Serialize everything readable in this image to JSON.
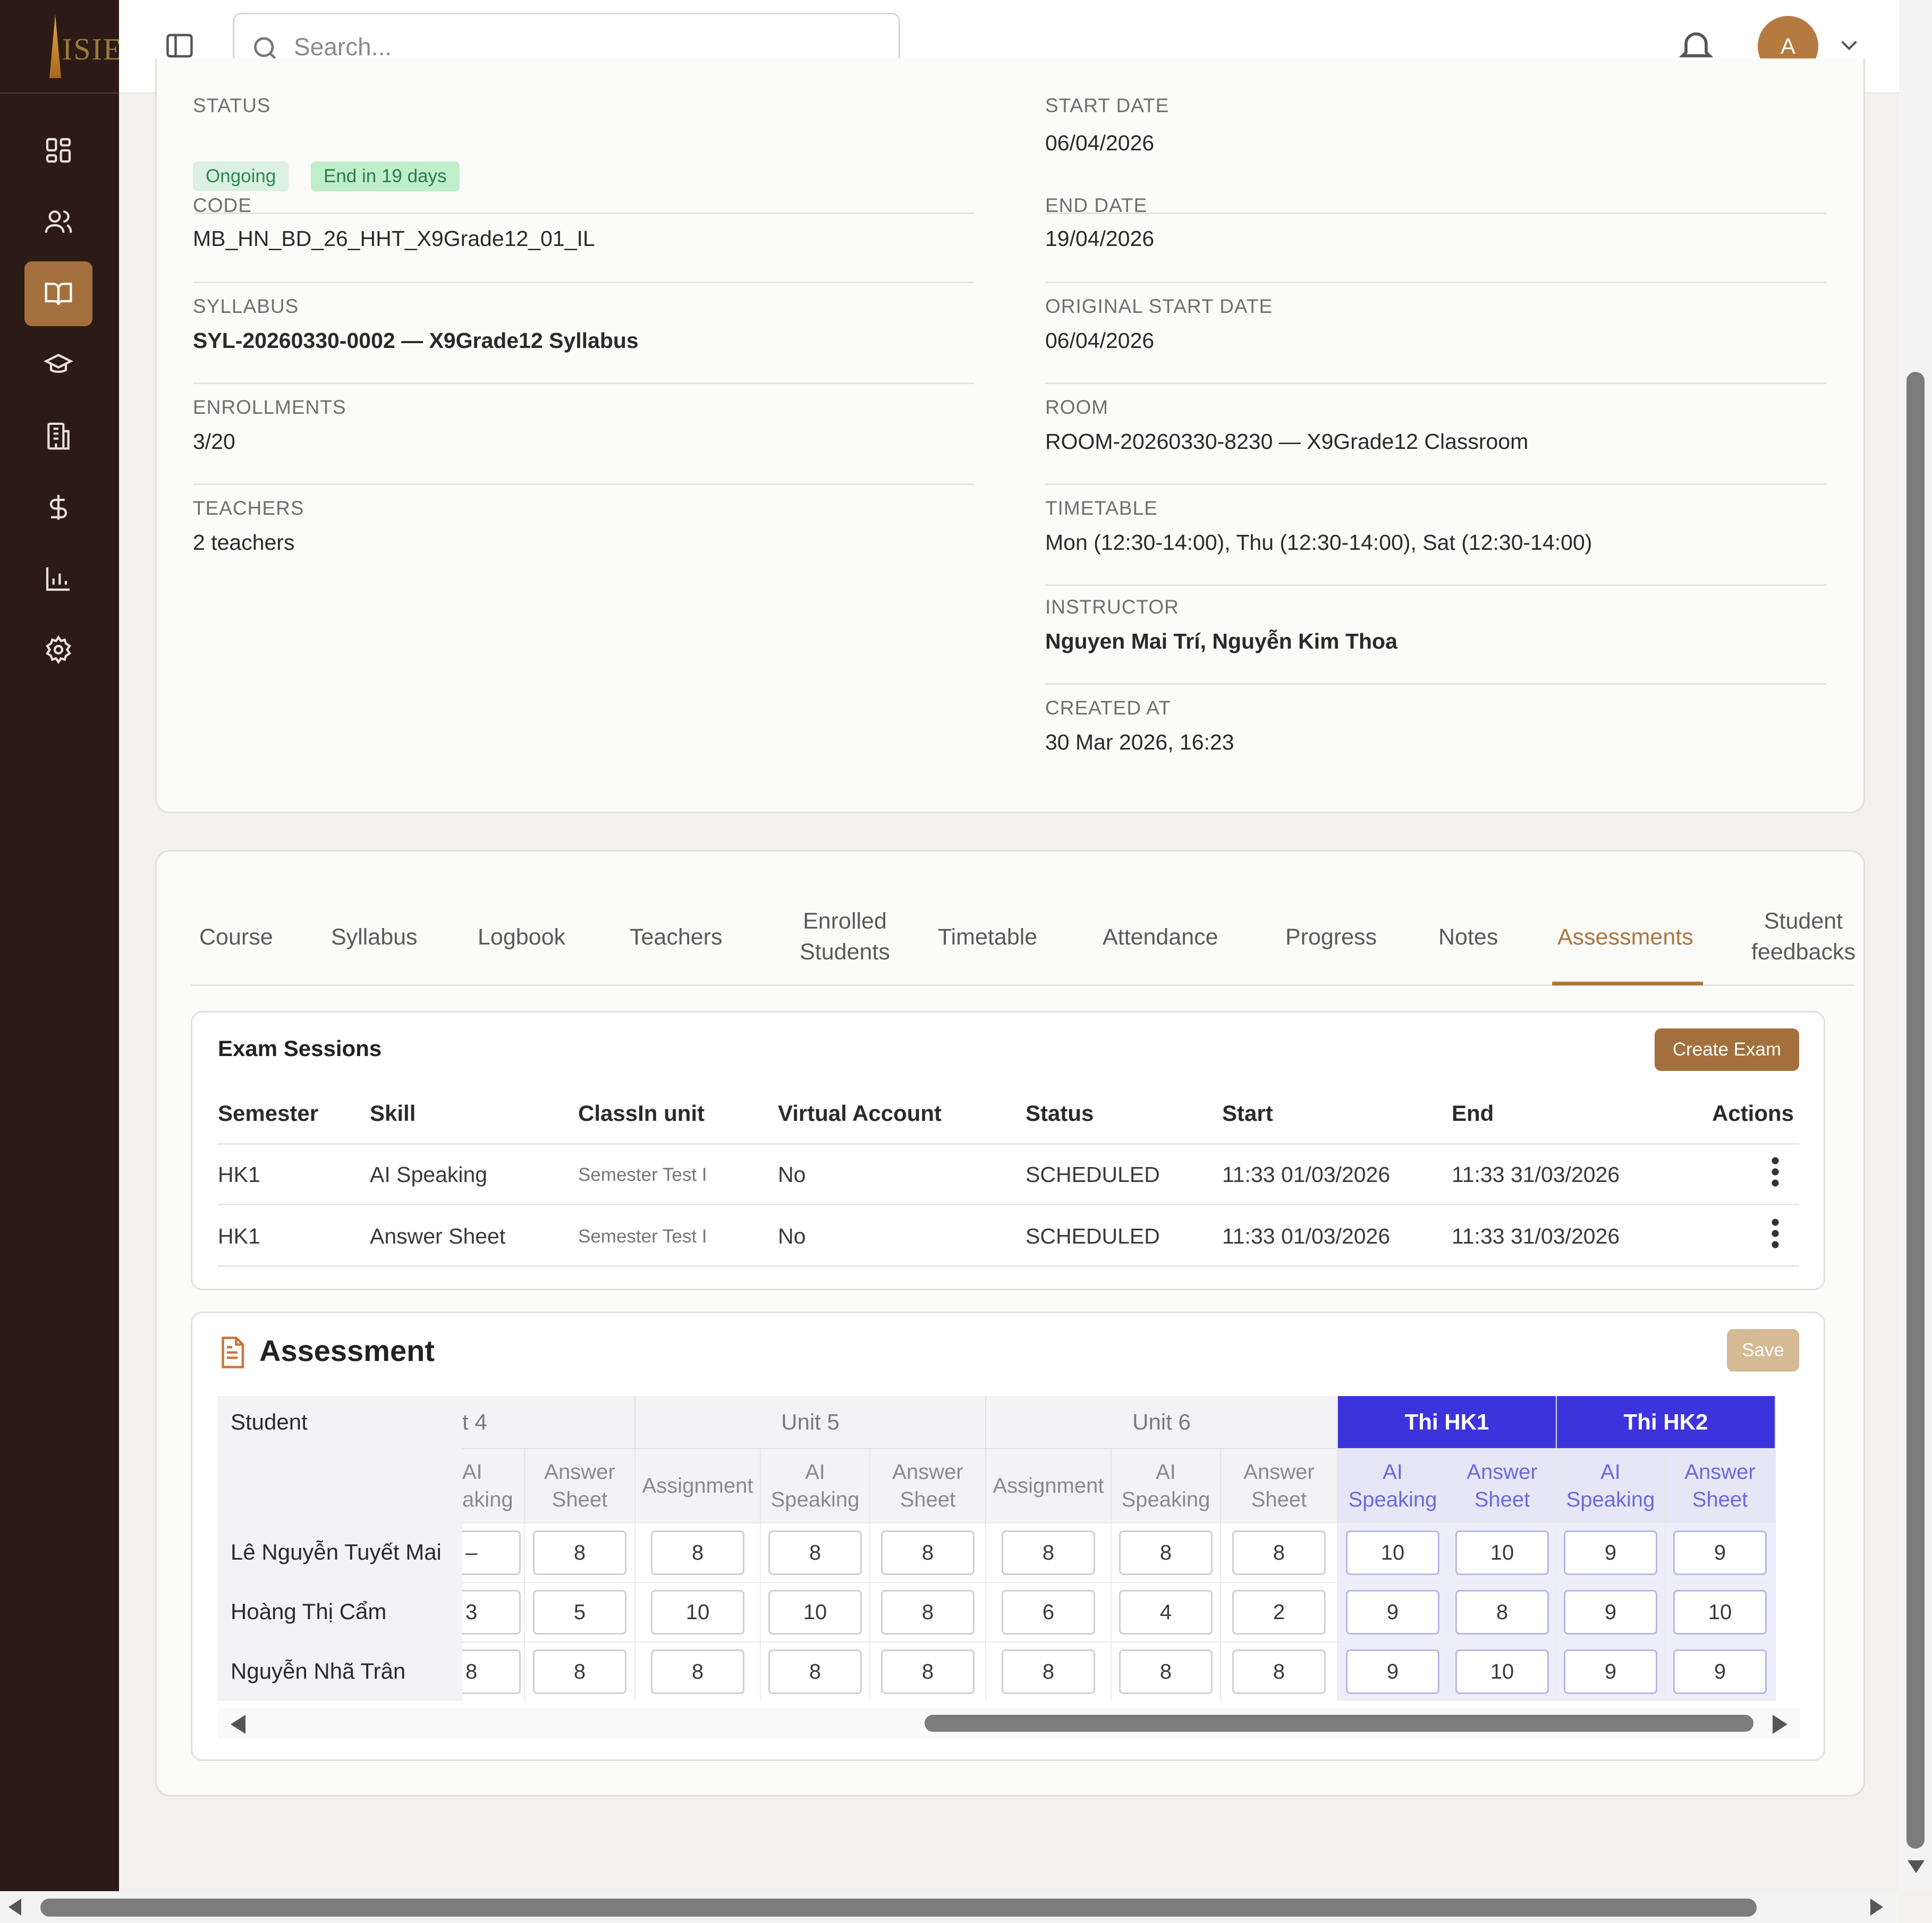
{
  "search": {
    "placeholder": "Search..."
  },
  "user": {
    "initial": "A"
  },
  "logo": {
    "text": "ISIE"
  },
  "nav": [
    "dashboard-icon",
    "users-icon",
    "book-icon",
    "graduation-cap-icon",
    "building-icon",
    "dollar-icon",
    "chart-icon",
    "settings-icon"
  ],
  "info": {
    "left": [
      {
        "label": "STATUS",
        "badges": [
          "Ongoing",
          "End in 19 days"
        ]
      },
      {
        "label": "CODE",
        "value": "MB_HN_BD_26_HHT_X9Grade12_01_IL"
      },
      {
        "label": "SYLLABUS",
        "value": "SYL-20260330-0002 — X9Grade12 Syllabus"
      },
      {
        "label": "ENROLLMENTS",
        "value": "3/20"
      },
      {
        "label": "TEACHERS",
        "value": "2 teachers"
      }
    ],
    "right": [
      {
        "label": "START DATE",
        "value": "06/04/2026"
      },
      {
        "label": "END DATE",
        "value": "19/04/2026"
      },
      {
        "label": "ORIGINAL START DATE",
        "value": "06/04/2026"
      },
      {
        "label": "ROOM",
        "value": "ROOM-20260330-8230 — X9Grade12 Classroom"
      },
      {
        "label": "TIMETABLE",
        "value": "Mon (12:30-14:00), Thu (12:30-14:00), Sat (12:30-14:00)"
      },
      {
        "label": "INSTRUCTOR",
        "value": "Nguyen Mai Trí, Nguyễn Kim Thoa"
      },
      {
        "label": "CREATED AT",
        "value": "30 Mar 2026, 16:23"
      }
    ]
  },
  "tabs": [
    "Course",
    "Syllabus",
    "Logbook",
    "Teachers",
    "Enrolled Students",
    "Timetable",
    "Attendance",
    "Progress",
    "Notes",
    "Assessments",
    "Student feedbacks"
  ],
  "active_tab": "Assessments",
  "exam_sessions": {
    "title": "Exam Sessions",
    "create_label": "Create Exam",
    "columns": [
      "Semester",
      "Skill",
      "ClassIn unit",
      "Virtual Account",
      "Status",
      "Start",
      "End",
      "Actions"
    ],
    "rows": [
      [
        "HK1",
        "AI Speaking",
        "Semester Test I",
        "No",
        "SCHEDULED",
        "11:33 01/03/2026",
        "11:33 31/03/2026"
      ],
      [
        "HK1",
        "Answer Sheet",
        "Semester Test I",
        "No",
        "SCHEDULED",
        "11:33 01/03/2026",
        "11:33 31/03/2026"
      ]
    ]
  },
  "assessment": {
    "title": "Assessment",
    "save_label": "Save",
    "student_header": "Student",
    "groups": [
      "t 4",
      "Unit 5",
      "Unit 6",
      "Thi HK1",
      "Thi HK2"
    ],
    "subcols": [
      "AI\naking",
      "Answer\nSheet",
      "Assignment",
      "AI\nSpeaking",
      "Answer\nSheet",
      "Assignment",
      "AI\nSpeaking",
      "Answer\nSheet",
      "AI\nSpeaking",
      "Answer\nSheet",
      "AI\nSpeaking",
      "Answer\nSheet"
    ],
    "students": [
      {
        "name": "Lê Nguyễn Tuyết Mai",
        "scores": [
          "–",
          "8",
          "8",
          "8",
          "8",
          "8",
          "8",
          "8",
          "10",
          "10",
          "9",
          "9"
        ]
      },
      {
        "name": "Hoàng Thị Cẩm",
        "scores": [
          "3",
          "5",
          "10",
          "10",
          "8",
          "6",
          "4",
          "2",
          "9",
          "8",
          "9",
          "10"
        ]
      },
      {
        "name": "Nguyễn Nhã Trân",
        "scores": [
          "8",
          "8",
          "8",
          "8",
          "8",
          "8",
          "8",
          "8",
          "9",
          "10",
          "9",
          "9"
        ]
      }
    ]
  },
  "colors": {
    "sidebar": "#2c1a16",
    "accent": "#a3703d",
    "exam_header": "#3d33dc"
  }
}
